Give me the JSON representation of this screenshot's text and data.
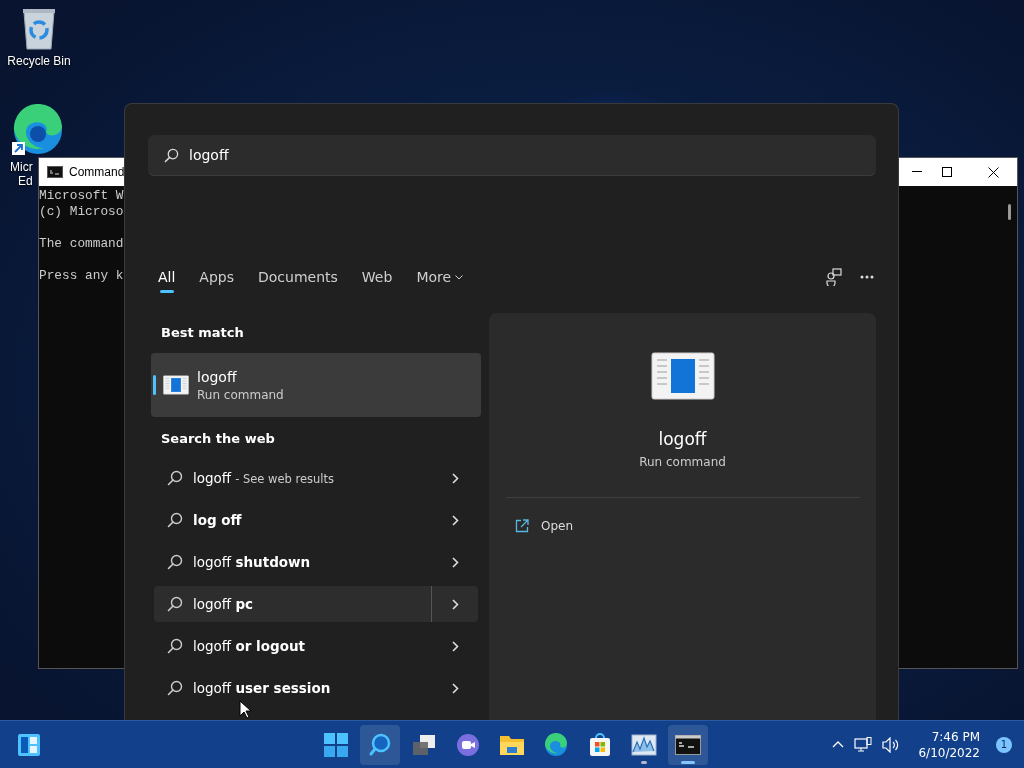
{
  "desktop_icons": [
    {
      "kind": "recycle",
      "lines": [
        "Recycle Bin"
      ]
    },
    {
      "kind": "edge",
      "lines": [
        "Micr",
        "Ed"
      ]
    }
  ],
  "cmd_window": {
    "title": "Command",
    "paragraphs": [
      [
        "Microsoft W",
        "(c) Microso"
      ],
      [
        "The command"
      ],
      [
        "Press any k"
      ]
    ]
  },
  "search_panel": {
    "query": "logoff",
    "tabs": [
      {
        "label": "All",
        "selected": true,
        "kind": "tab"
      },
      {
        "label": "Apps",
        "selected": false,
        "kind": "tab"
      },
      {
        "label": "Documents",
        "selected": false,
        "kind": "tab"
      },
      {
        "label": "Web",
        "selected": false,
        "kind": "tab"
      },
      {
        "label": "More",
        "selected": false,
        "kind": "dropdown"
      }
    ],
    "best_match": {
      "heading": "Best match",
      "title": "logoff",
      "subtitle": "Run command",
      "selected": true
    },
    "web": {
      "heading": "Search the web",
      "results": [
        {
          "text": "logoff",
          "suffix": "- See web results",
          "selected": false
        },
        {
          "text": "**log off**",
          "selected": false
        },
        {
          "text": "logoff **shutdown**",
          "selected": false
        },
        {
          "text": "logoff **pc**",
          "selected": true
        },
        {
          "text": "logoff **or logout**",
          "selected": false
        },
        {
          "text": "logoff **user session**",
          "selected": false
        }
      ]
    },
    "preview": {
      "title": "logoff",
      "subtitle": "Run command",
      "actions": [
        {
          "label": "Open"
        }
      ]
    }
  },
  "taskbar": {
    "apps": [
      {
        "kind": "start",
        "selected": false,
        "running": false
      },
      {
        "kind": "search",
        "selected": true,
        "running": false
      },
      {
        "kind": "taskview",
        "selected": false,
        "running": false
      },
      {
        "kind": "chat",
        "selected": false,
        "running": false
      },
      {
        "kind": "explorer",
        "selected": false,
        "running": false
      },
      {
        "kind": "edge",
        "selected": false,
        "running": false
      },
      {
        "kind": "store",
        "selected": false,
        "running": false
      },
      {
        "kind": "perfmon",
        "selected": false,
        "running": true
      },
      {
        "kind": "terminal",
        "selected": true,
        "running": true
      }
    ],
    "clock": {
      "time": "7:46 PM",
      "date": "6/10/2022"
    },
    "notification_count": "1"
  }
}
